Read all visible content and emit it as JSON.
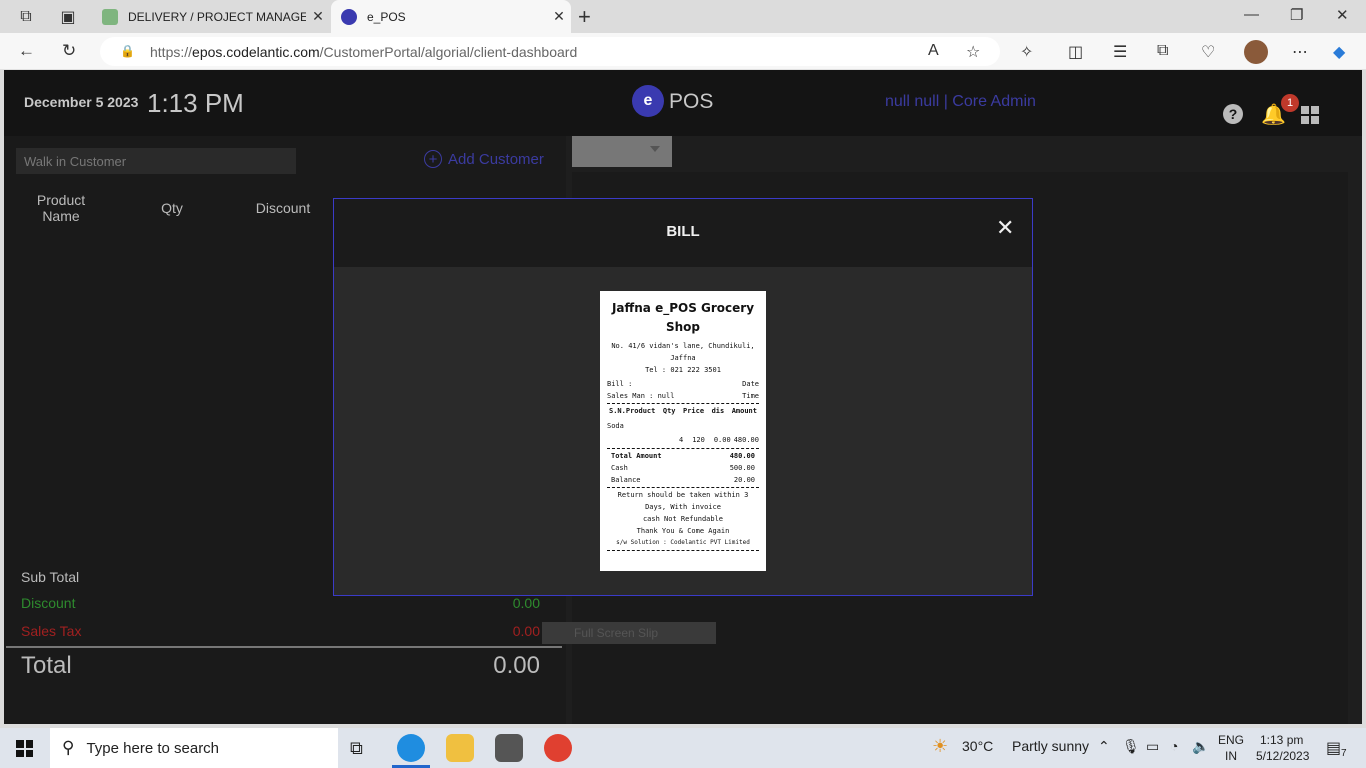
{
  "browser": {
    "tabs": [
      {
        "title": "DELIVERY / PROJECT MANAGEMENT",
        "active": false
      },
      {
        "title": "e_POS",
        "active": true
      }
    ],
    "url_prefix": "https://",
    "url_host": "epos.codelantic.com",
    "url_path": "/CustomerPortal/algorial/client-dashboard"
  },
  "header": {
    "date": "December 5 2023",
    "time": "1:13 PM",
    "logo_text": "POS",
    "user": "null null | Core Admin",
    "notification_count": "1"
  },
  "order": {
    "customer_placeholder": "Walk in Customer",
    "add_customer": "Add Customer",
    "columns": [
      "Product Name",
      "Qty",
      "Discount"
    ],
    "sub_total_label": "Sub Total",
    "discount_label": "Discount",
    "discount_value": "0.00",
    "sales_tax_label": "Sales Tax",
    "sales_tax_value": "0.00",
    "total_label": "Total",
    "total_value": "0.00"
  },
  "right": {
    "fullscreen_label": "Full Screen Slip"
  },
  "modal": {
    "title": "BILL",
    "close": "✕"
  },
  "receipt": {
    "shop_name": "Jaffna e_POS Grocery Shop",
    "address": "No. 41/6 vidan's lane, Chundikuli, Jaffna",
    "tel": "Tel : 021 222 3501",
    "bill_label": "Bill :",
    "date_label": "Date",
    "salesman": "Sales Man : null",
    "time_label": "Time",
    "table_header": [
      "S.N.",
      "Product",
      "Qty",
      "Price",
      "dis",
      "Amount"
    ],
    "items": [
      {
        "name": "Soda",
        "qty": "4",
        "price": "120",
        "dis": "0.00",
        "amount": "480.00"
      }
    ],
    "total_amount_label": "Total Amount",
    "total_amount": "480.00",
    "cash_label": "Cash",
    "cash": "500.00",
    "balance_label": "Balance",
    "balance": "20.00",
    "footer": [
      "Return should be taken within 3 Days, With invoice",
      "cash Not Refundable",
      "Thank You & Come Again",
      "s/w Solution : Codelantic PVT Limited"
    ]
  },
  "taskbar": {
    "search_placeholder": "Type here to search",
    "weather_temp": "30°C",
    "weather_text": "Partly sunny",
    "lang": "ENG",
    "region": "IN",
    "clock_time": "1:13 pm",
    "clock_date": "5/12/2023",
    "notif_count": "7"
  }
}
